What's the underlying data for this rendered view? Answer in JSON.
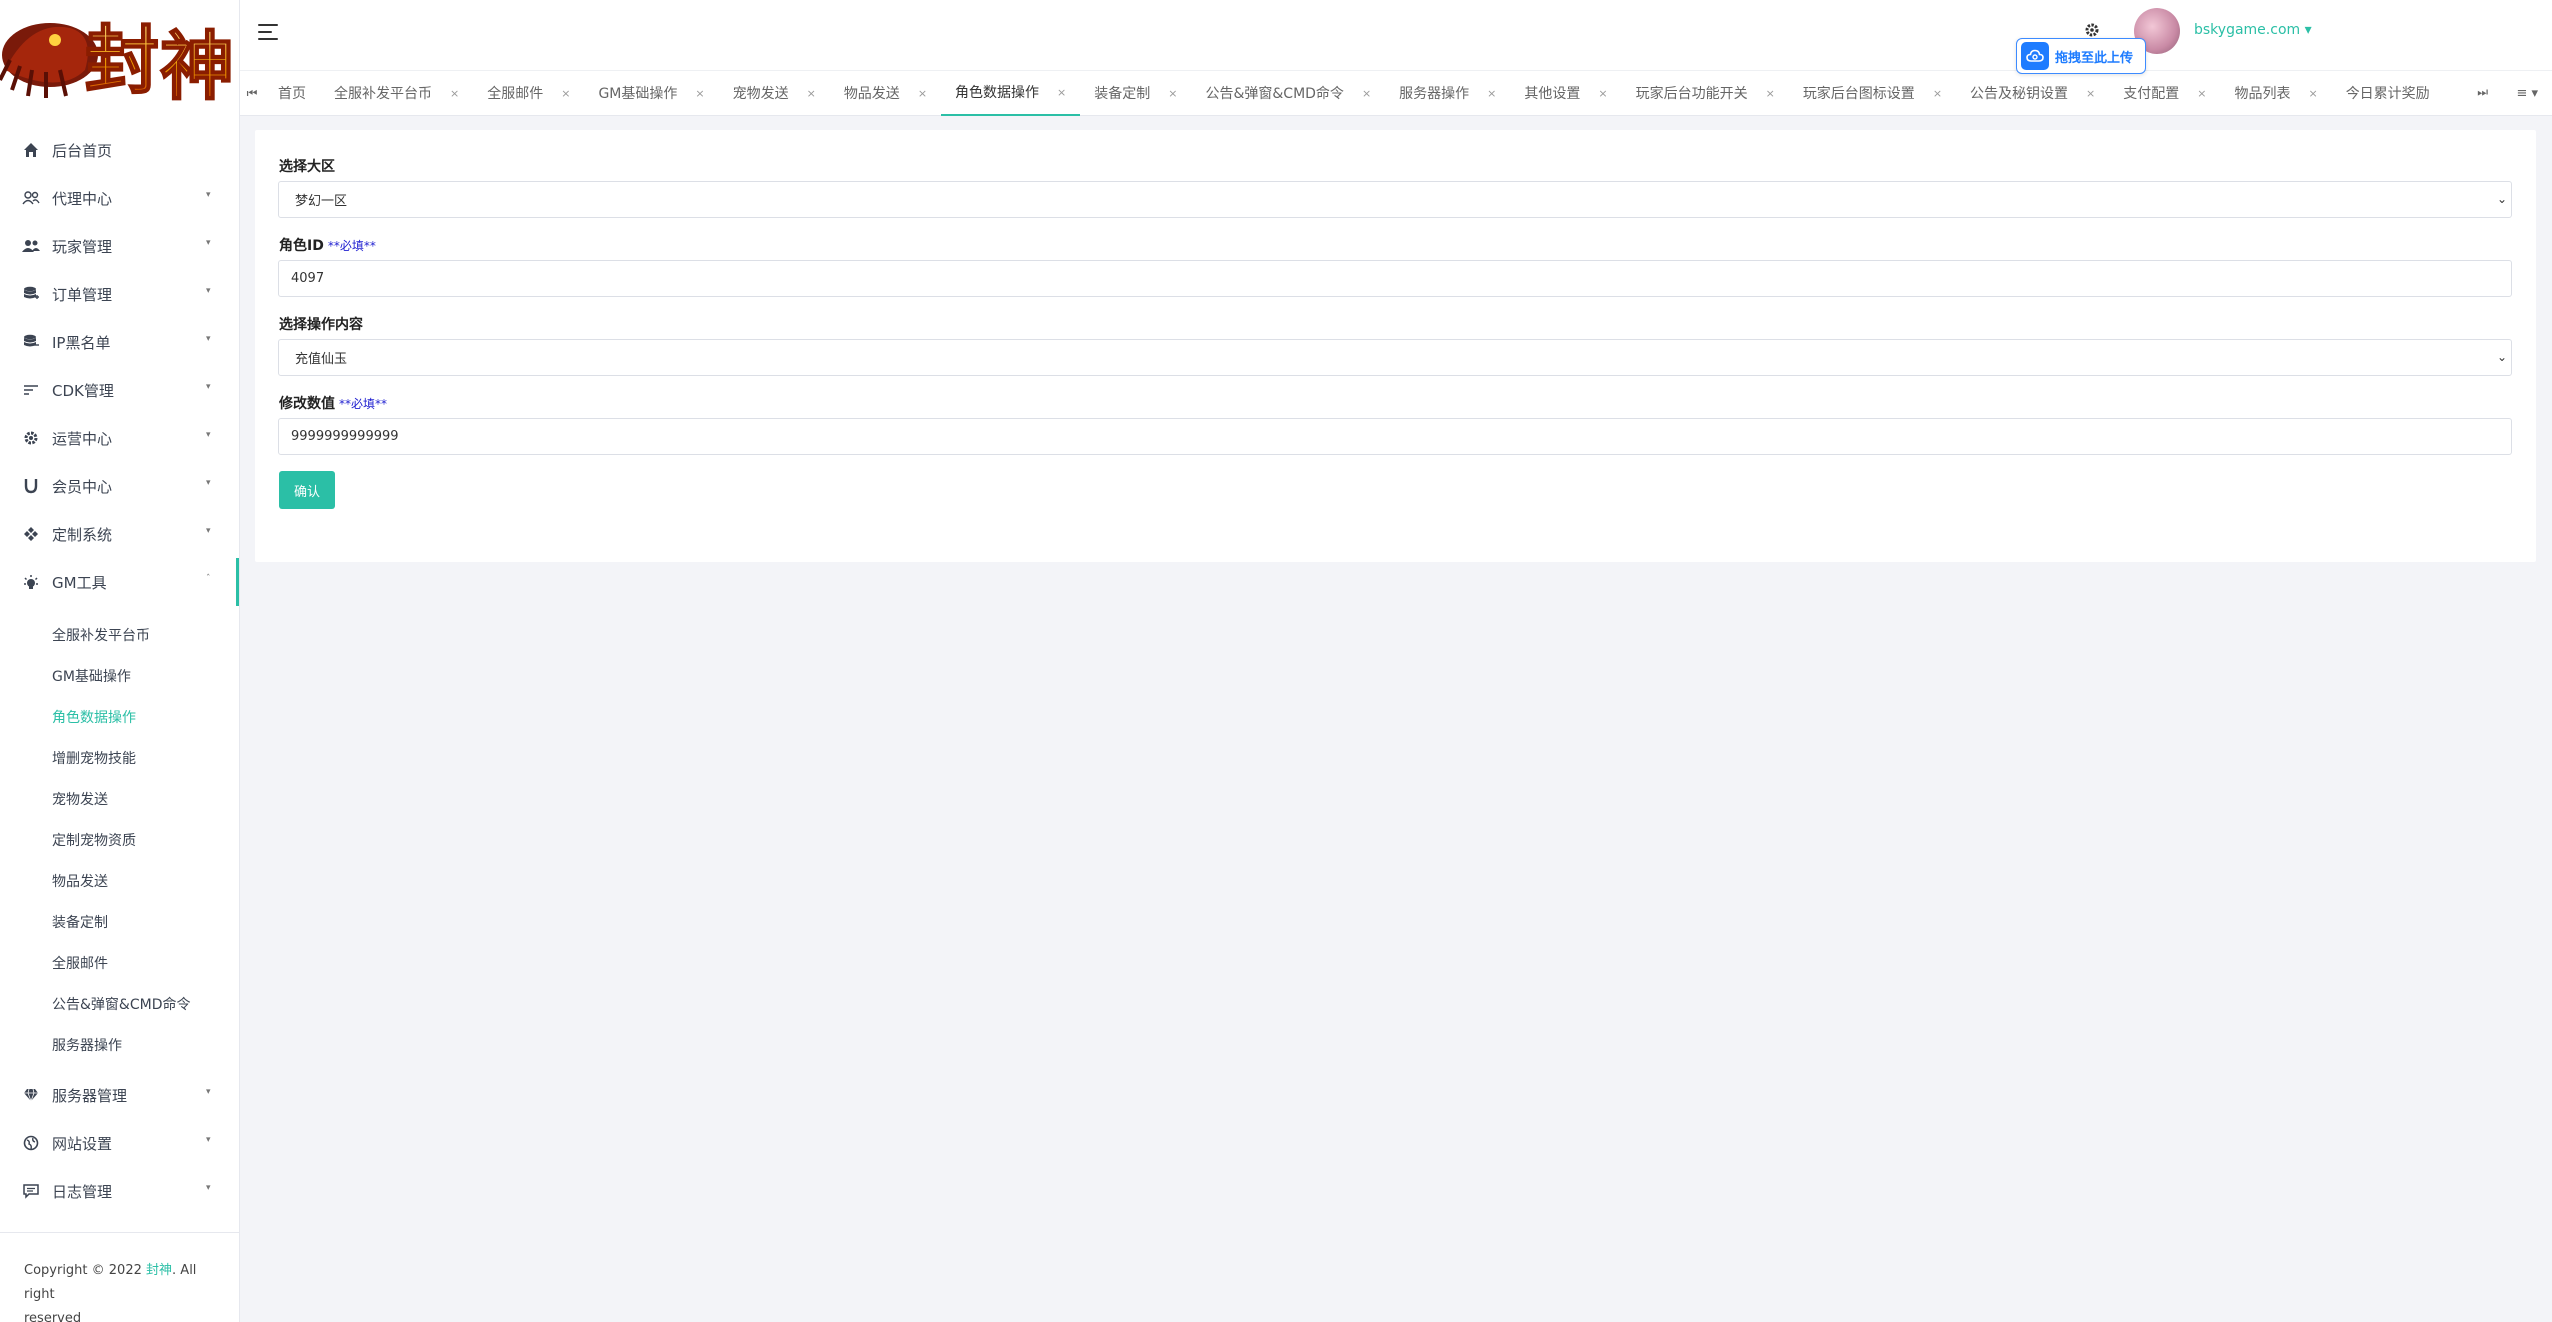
{
  "logo": {
    "text": "封神"
  },
  "sidebar": {
    "items": [
      {
        "label": "后台首页",
        "icon": "home-icon"
      },
      {
        "label": "代理中心",
        "icon": "users-outline-icon"
      },
      {
        "label": "玩家管理",
        "icon": "users-icon"
      },
      {
        "label": "订单管理",
        "icon": "database-icon"
      },
      {
        "label": "IP黑名单",
        "icon": "database-icon"
      },
      {
        "label": "CDK管理",
        "icon": "sort-icon"
      },
      {
        "label": "运营中心",
        "icon": "gear-icon"
      },
      {
        "label": "会员中心",
        "icon": "magnet-icon"
      },
      {
        "label": "定制系统",
        "icon": "gamepad-icon"
      },
      {
        "label": "GM工具",
        "icon": "bulb-icon"
      },
      {
        "label": "服务器管理",
        "icon": "diamond-icon"
      },
      {
        "label": "网站设置",
        "icon": "globe-icon"
      },
      {
        "label": "日志管理",
        "icon": "comment-icon"
      }
    ],
    "gm_sub": [
      "全服补发平台币",
      "GM基础操作",
      "角色数据操作",
      "增删宠物技能",
      "宠物发送",
      "定制宠物资质",
      "物品发送",
      "装备定制",
      "全服邮件",
      "公告&弹窗&CMD命令",
      "服务器操作"
    ]
  },
  "copyright": {
    "prefix": "Copyright © 2022",
    "brand": "封神",
    "suffix": ". All right",
    "line2": "reserved"
  },
  "header": {
    "username": "bskygame.com",
    "upload_label": "拖拽至此上传"
  },
  "tabs": [
    "首页",
    "全服补发平台币",
    "全服邮件",
    "GM基础操作",
    "宠物发送",
    "物品发送",
    "角色数据操作",
    "装备定制",
    "公告&弹窗&CMD命令",
    "服务器操作",
    "其他设置",
    "玩家后台功能开关",
    "玩家后台图标设置",
    "公告及秘钥设置",
    "支付配置",
    "物品列表",
    "今日累计奖励"
  ],
  "form": {
    "region_label": "选择大区",
    "region_value": "梦幻一区",
    "role_label": "角色ID",
    "required_mark": "**必填**",
    "role_value": "4097",
    "op_label": "选择操作内容",
    "op_value": "充值仙玉",
    "amount_label": "修改数值",
    "amount_value": "9999999999999",
    "confirm_label": "确认"
  },
  "colors": {
    "accent": "#2bbfa6",
    "required": "#1f1fd0",
    "upload": "#1e7cff"
  }
}
